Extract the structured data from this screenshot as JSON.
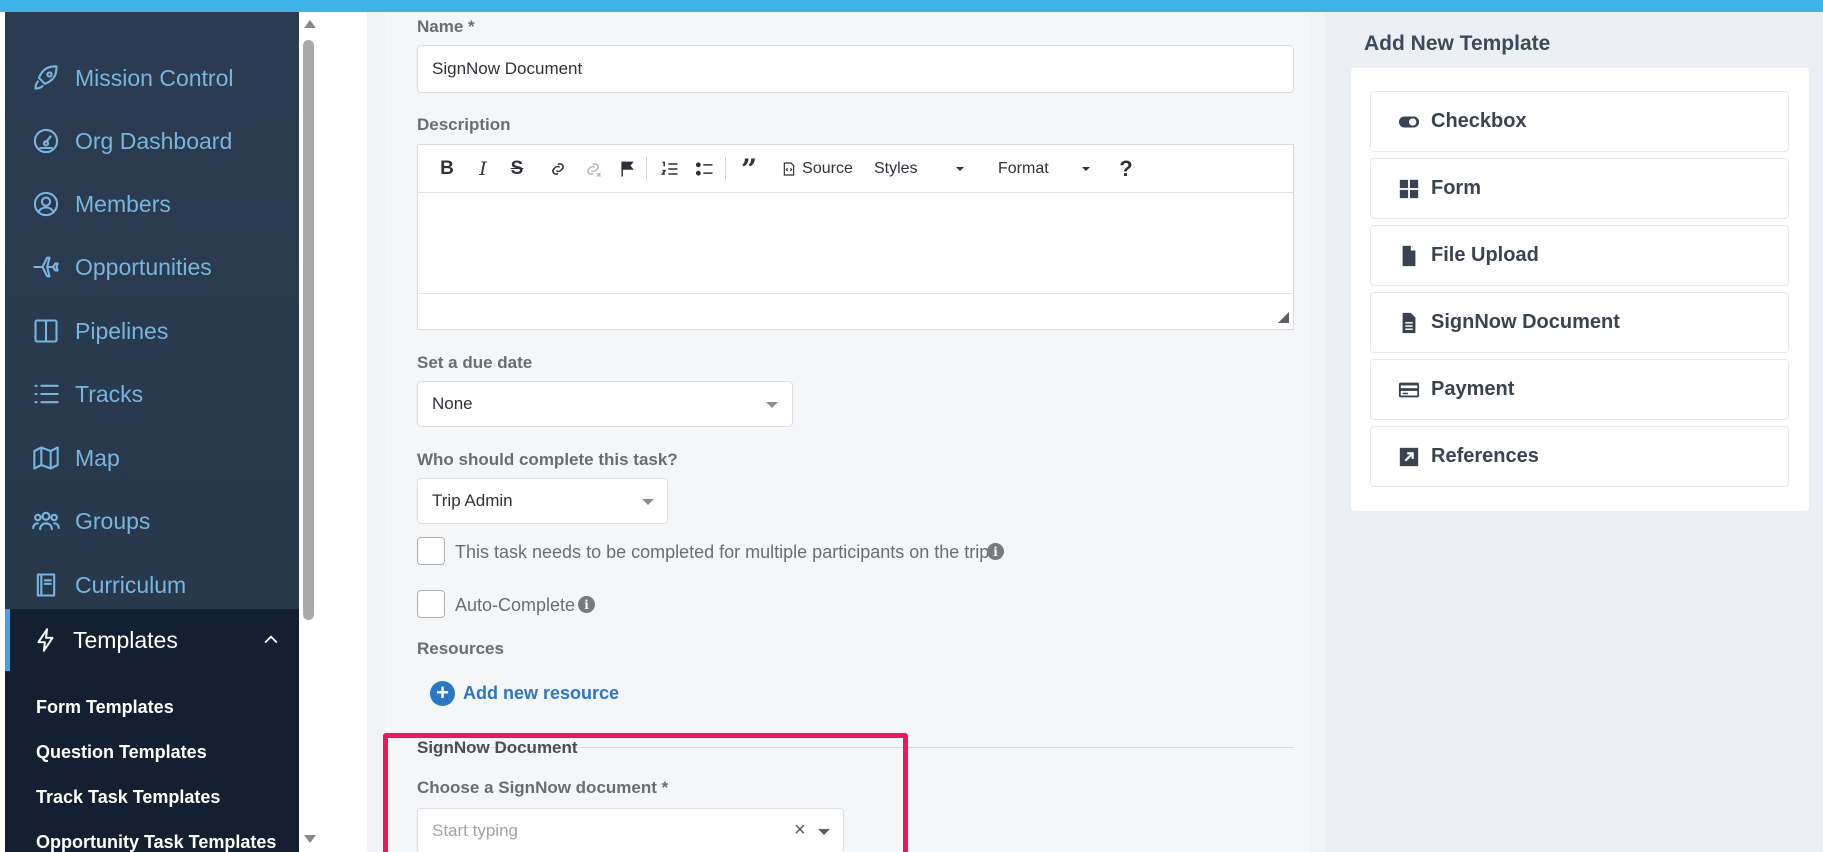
{
  "sidebar": {
    "items": [
      {
        "label": "Mission Control",
        "icon": "rocket-icon"
      },
      {
        "label": "Org Dashboard",
        "icon": "gauge-icon"
      },
      {
        "label": "Members",
        "icon": "user-circle-icon"
      },
      {
        "label": "Opportunities",
        "icon": "plane-icon"
      },
      {
        "label": "Pipelines",
        "icon": "columns-icon"
      },
      {
        "label": "Tracks",
        "icon": "list-icon"
      },
      {
        "label": "Map",
        "icon": "map-icon"
      },
      {
        "label": "Groups",
        "icon": "users-icon"
      },
      {
        "label": "Curriculum",
        "icon": "book-icon"
      }
    ],
    "active": {
      "label": "Templates",
      "icon": "lightning-icon"
    },
    "submenu": [
      "Form Templates",
      "Question Templates",
      "Track Task Templates",
      "Opportunity Task Templates"
    ]
  },
  "form": {
    "name_label": "Name *",
    "name_value": "SignNow Document",
    "description_label": "Description",
    "toolbar": {
      "source": "Source",
      "styles": "Styles",
      "format": "Format",
      "help": "?"
    },
    "due_date_label": "Set a due date",
    "due_date_value": "None",
    "assignee_label": "Who should complete this task?",
    "assignee_value": "Trip Admin",
    "multi_participant_label": "This task needs to be completed for multiple participants on the trip",
    "auto_complete_label": "Auto-Complete",
    "resources_label": "Resources",
    "add_resource_label": "Add new resource",
    "signnow_section_title": "SignNow Document",
    "signnow_choose_label": "Choose a SignNow document *",
    "signnow_placeholder": "Start typing",
    "clear_glyph": "×"
  },
  "right_panel": {
    "title": "Add New Template",
    "templates": [
      {
        "label": "Checkbox",
        "icon": "toggle-icon"
      },
      {
        "label": "Form",
        "icon": "grid-icon"
      },
      {
        "label": "File Upload",
        "icon": "file-icon"
      },
      {
        "label": "SignNow Document",
        "icon": "document-icon"
      },
      {
        "label": "Payment",
        "icon": "credit-card-icon"
      },
      {
        "label": "References",
        "icon": "external-link-icon"
      }
    ]
  },
  "colors": {
    "topbar": "#3fb3e8",
    "sidebar_bg": "#2b3c52",
    "sidebar_text": "#79b4de",
    "active_bg": "#142031",
    "link_blue": "#2b77c5",
    "highlight": "#f0155f"
  }
}
